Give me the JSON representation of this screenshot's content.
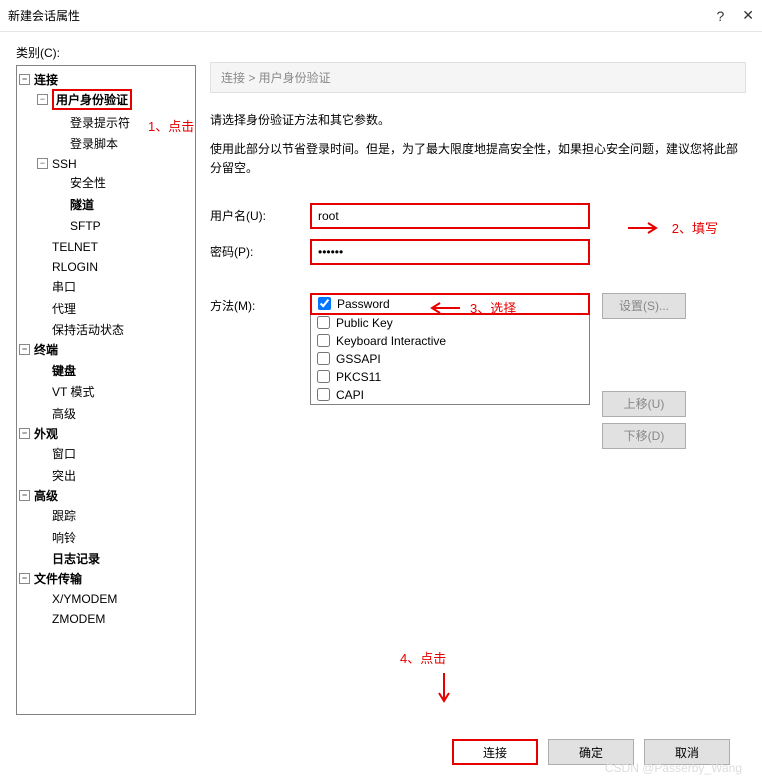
{
  "title": "新建会话属性",
  "category_label": "类别(C):",
  "tree": {
    "connection": "连接",
    "user_auth": "用户身份验证",
    "login_prompt": "登录提示符",
    "login_script": "登录脚本",
    "ssh": "SSH",
    "security": "安全性",
    "tunnel": "隧道",
    "sftp": "SFTP",
    "telnet": "TELNET",
    "rlogin": "RLOGIN",
    "serial": "串口",
    "proxy": "代理",
    "keepalive": "保持活动状态",
    "terminal": "终端",
    "keyboard": "键盘",
    "vtmode": "VT 模式",
    "advanced_term": "高级",
    "appearance": "外观",
    "window": "窗口",
    "highlight": "突出",
    "advanced": "高级",
    "trace": "跟踪",
    "bell": "响铃",
    "log": "日志记录",
    "filetransfer": "文件传输",
    "xymodem": "X/YMODEM",
    "zmodem": "ZMODEM"
  },
  "breadcrumb": "连接 > 用户身份验证",
  "desc1": "请选择身份验证方法和其它参数。",
  "desc2": "使用此部分以节省登录时间。但是，为了最大限度地提高安全性，如果担心安全问题，建议您将此部分留空。",
  "form": {
    "username_label": "用户名(U):",
    "username_value": "root",
    "password_label": "密码(P):",
    "password_value": "••••••",
    "method_label": "方法(M):"
  },
  "methods": [
    "Password",
    "Public Key",
    "Keyboard Interactive",
    "GSSAPI",
    "PKCS11",
    "CAPI"
  ],
  "buttons": {
    "setup": "设置(S)...",
    "up": "上移(U)",
    "down": "下移(D)",
    "connect": "连接",
    "ok": "确定",
    "cancel": "取消"
  },
  "annotations": {
    "click1": "1、点击",
    "fill2": "2、填写",
    "select3": "3、选择",
    "click4": "4、点击"
  },
  "watermark": "CSDN @Passerby_Wang"
}
